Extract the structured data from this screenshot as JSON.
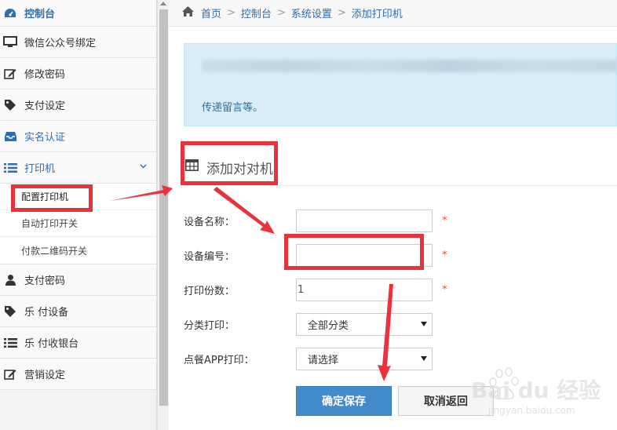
{
  "sidebar": {
    "items": [
      {
        "label": "控制台",
        "icon": "dashboard-icon"
      },
      {
        "label": "微信公众号绑定",
        "icon": "monitor-icon"
      },
      {
        "label": "修改密码",
        "icon": "edit-icon"
      },
      {
        "label": "支付设定",
        "icon": "tag-icon"
      },
      {
        "label": "实名认证",
        "icon": "inbox-icon"
      },
      {
        "label": "打印机",
        "icon": "list-icon"
      },
      {
        "label": "支付密码",
        "icon": "user-icon"
      },
      {
        "label": "乐  付设备",
        "icon": "tag-icon"
      },
      {
        "label": "乐  付收银台",
        "icon": "list-icon"
      },
      {
        "label": "营销设定",
        "icon": "edit-icon"
      }
    ],
    "printer_sub": [
      {
        "label": "配置打印机"
      },
      {
        "label": "自动打印开关"
      },
      {
        "label": "付款二维码开关"
      }
    ]
  },
  "breadcrumb": {
    "home": "首页",
    "items": [
      "控制台",
      "系统设置",
      "添加打印机"
    ]
  },
  "notice": {
    "text": "传递留言等。"
  },
  "section": {
    "title": "添加对对机"
  },
  "form": {
    "device_name_label": "设备名称：",
    "device_name_value": "",
    "device_no_label": "设备编号：",
    "device_no_value": "",
    "copies_label": "打印份数：",
    "copies_value": "1",
    "category_label": "分类打印：",
    "category_value": "全部分类",
    "app_label": "点餐APP打印：",
    "app_value": "请选择",
    "required_mark": "*"
  },
  "buttons": {
    "save": "确定保存",
    "cancel": "取消返回"
  },
  "watermark": {
    "brand": "Bai du 经验",
    "url": "jingyan.baidu.com"
  },
  "colors": {
    "accent": "#2a6fb1",
    "primary_button": "#428bca",
    "notice_bg": "#d9edf7",
    "annotation_red": "#e8323c",
    "required": "#e74c3c"
  }
}
